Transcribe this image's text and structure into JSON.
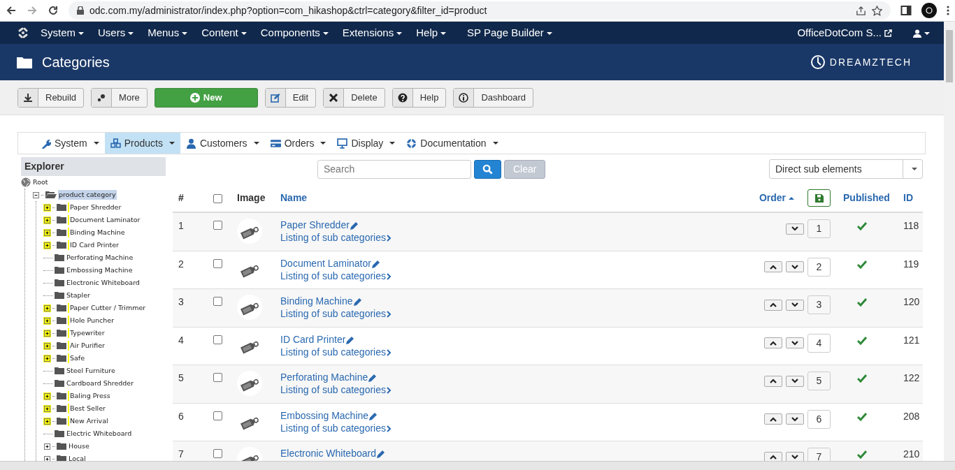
{
  "browser": {
    "url": "odc.com.my/administrator/index.php?option=com_hikashop&ctrl=category&filter_id=product"
  },
  "menu": {
    "items": [
      "System",
      "Users",
      "Menus",
      "Content",
      "Components",
      "Extensions",
      "Help",
      "SP Page Builder"
    ],
    "site_link": "OfficeDotCom S..."
  },
  "header": {
    "title": "Categories",
    "brand": "DREAMZTECH"
  },
  "toolbar": [
    {
      "label": "Rebuild",
      "kind": "rebuild"
    },
    {
      "label": "More",
      "kind": "more"
    },
    {
      "label": "New",
      "kind": "new"
    },
    {
      "label": "Edit",
      "kind": "edit"
    },
    {
      "label": "Delete",
      "kind": "delete"
    },
    {
      "label": "Help",
      "kind": "help"
    },
    {
      "label": "Dashboard",
      "kind": "dashboard"
    }
  ],
  "submenu": [
    {
      "label": "System",
      "kind": "wrench",
      "selected": false
    },
    {
      "label": "Products",
      "kind": "cubes",
      "selected": true
    },
    {
      "label": "Customers",
      "kind": "user",
      "selected": false
    },
    {
      "label": "Orders",
      "kind": "card",
      "selected": false
    },
    {
      "label": "Display",
      "kind": "monitor",
      "selected": false
    },
    {
      "label": "Documentation",
      "kind": "lifebuoy",
      "selected": false
    }
  ],
  "explorer": {
    "title": "Explorer",
    "tree": [
      {
        "label": "Root",
        "selected": false,
        "children": [
          {
            "label": "product category",
            "selected": true,
            "expanded": true,
            "children": [
              {
                "label": "Paper Shredder",
                "expandable": true,
                "highlighted": true
              },
              {
                "label": "Document Laminator",
                "expandable": true,
                "highlighted": true
              },
              {
                "label": "Binding Machine",
                "expandable": true,
                "highlighted": true
              },
              {
                "label": "ID Card Printer",
                "expandable": true,
                "highlighted": true
              },
              {
                "label": "Perforating Machine",
                "expandable": false,
                "highlighted": false
              },
              {
                "label": "Embossing Machine",
                "expandable": false,
                "highlighted": false
              },
              {
                "label": "Electronic Whiteboard",
                "expandable": false,
                "highlighted": false
              },
              {
                "label": "Stapler",
                "expandable": false,
                "highlighted": false
              },
              {
                "label": "Paper Cutter / Trimmer",
                "expandable": true,
                "highlighted": true
              },
              {
                "label": "Hole Puncher",
                "expandable": true,
                "highlighted": true
              },
              {
                "label": "Typewriter",
                "expandable": true,
                "highlighted": true
              },
              {
                "label": "Air Purifier",
                "expandable": true,
                "highlighted": true
              },
              {
                "label": "Safe",
                "expandable": true,
                "highlighted": true
              },
              {
                "label": "Steel Furniture",
                "expandable": false,
                "highlighted": false
              },
              {
                "label": "Cardboard Shredder",
                "expandable": false,
                "highlighted": false
              },
              {
                "label": "Baling Press",
                "expandable": true,
                "highlighted": true
              },
              {
                "label": "Best Seller",
                "expandable": true,
                "highlighted": true
              },
              {
                "label": "New Arrival",
                "expandable": true,
                "highlighted": true
              },
              {
                "label": "Electric Whiteboard",
                "expandable": false,
                "highlighted": false
              },
              {
                "label": "House",
                "expandable": true,
                "highlighted": false
              },
              {
                "label": "Local",
                "expandable": true,
                "highlighted": false
              }
            ]
          }
        ]
      }
    ]
  },
  "search": {
    "placeholder": "Search",
    "clear": "Clear"
  },
  "filter": {
    "value": "Direct sub elements"
  },
  "table": {
    "select_all_checked": false,
    "columns": [
      {
        "label": "#",
        "sortable": false
      },
      {
        "label": "Image",
        "sortable": false
      },
      {
        "label": "Name",
        "sortable": true
      },
      {
        "label": "Order",
        "sortable": true,
        "sorted_ascending": true
      },
      {
        "label": "Published",
        "sortable": true
      },
      {
        "label": "ID",
        "sortable": true
      }
    ],
    "rows": [
      {
        "number": "1",
        "checked": false,
        "name": "Paper Shredder",
        "link": "Listing of sub categories",
        "can_move_up": false,
        "can_move_down": true,
        "order": "1",
        "published": true,
        "id": "118"
      },
      {
        "number": "2",
        "checked": false,
        "name": "Document Laminator",
        "link": "Listing of sub categories",
        "can_move_up": true,
        "can_move_down": true,
        "order": "2",
        "published": true,
        "id": "119"
      },
      {
        "number": "3",
        "checked": false,
        "name": "Binding Machine",
        "link": "Listing of sub categories",
        "can_move_up": true,
        "can_move_down": true,
        "order": "3",
        "published": true,
        "id": "120"
      },
      {
        "number": "4",
        "checked": false,
        "name": "ID Card Printer",
        "link": "Listing of sub categories",
        "can_move_up": true,
        "can_move_down": true,
        "order": "4",
        "published": true,
        "id": "121"
      },
      {
        "number": "5",
        "checked": false,
        "name": "Perforating Machine",
        "link": "Listing of sub categories",
        "can_move_up": true,
        "can_move_down": true,
        "order": "5",
        "published": true,
        "id": "122"
      },
      {
        "number": "6",
        "checked": false,
        "name": "Embossing Machine",
        "link": "Listing of sub categories",
        "can_move_up": true,
        "can_move_down": true,
        "order": "6",
        "published": true,
        "id": "208"
      },
      {
        "number": "7",
        "checked": false,
        "name": "Electronic Whiteboard",
        "can_move_up": true,
        "can_move_down": true,
        "order": "7",
        "published": true,
        "id": "210"
      }
    ]
  }
}
